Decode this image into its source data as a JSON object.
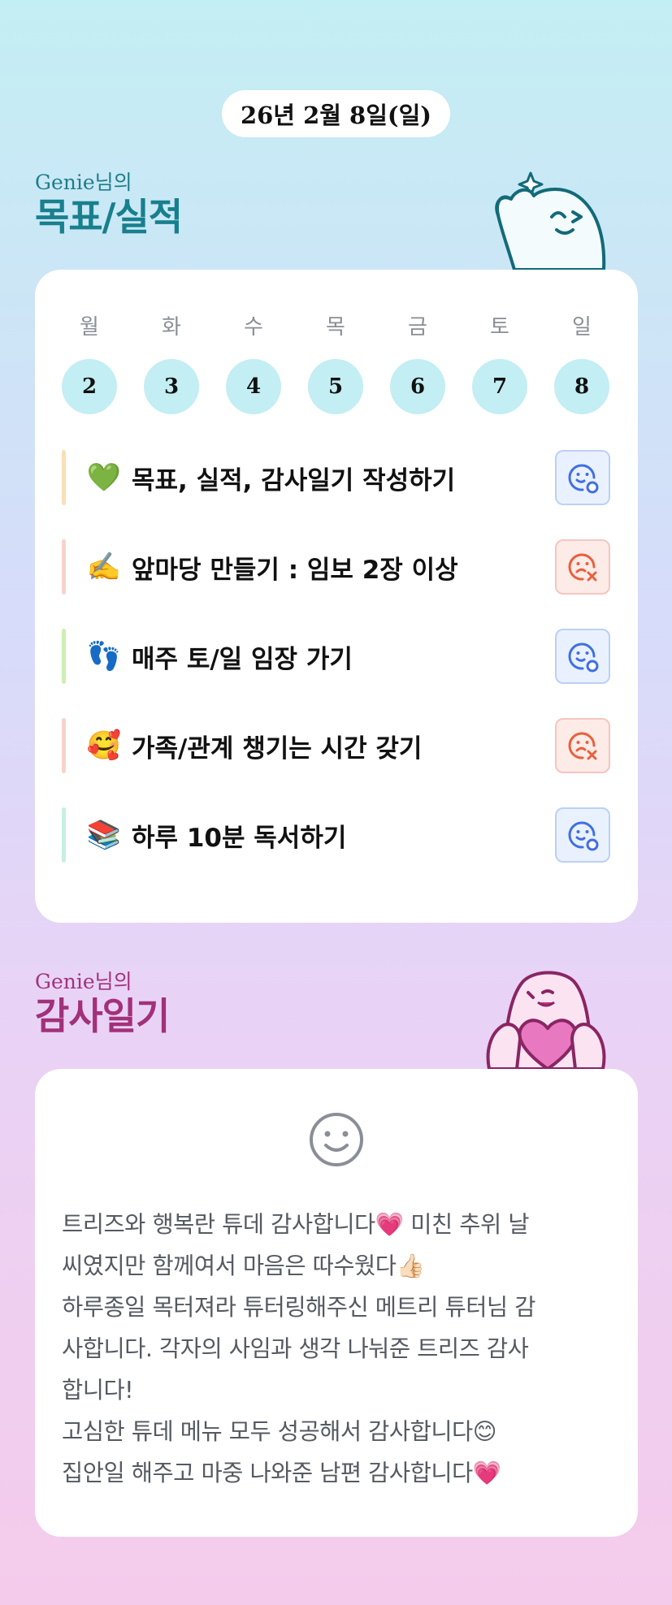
{
  "header": {
    "date": "26년 2월 8일(일)"
  },
  "goals_section": {
    "owner": "Genie님의",
    "title": "목표/실적",
    "weekdays": [
      "월",
      "화",
      "수",
      "목",
      "금",
      "토",
      "일"
    ],
    "dates": [
      "2",
      "3",
      "4",
      "5",
      "6",
      "7",
      "8"
    ],
    "items": [
      {
        "emoji": "💚",
        "label": "목표, 실적, 감사일기 작성하기",
        "status": "done",
        "status_icon": "smile-check-icon",
        "bar_color": "#f9dfb8"
      },
      {
        "emoji": "✍️",
        "label": "앞마당 만들기 : 임보 2장 이상",
        "status": "fail",
        "status_icon": "frown-x-icon",
        "bar_color": "#f8d3cc"
      },
      {
        "emoji": "👣",
        "label": "매주 토/일 임장 가기",
        "status": "done",
        "status_icon": "smile-check-icon",
        "bar_color": "#cfeeb4"
      },
      {
        "emoji": "🥰",
        "label": "가족/관계 챙기는 시간 갖기",
        "status": "fail",
        "status_icon": "frown-x-icon",
        "bar_color": "#f8d3cc"
      },
      {
        "emoji": "📚",
        "label": "하루 10분 독서하기",
        "status": "done",
        "status_icon": "smile-check-icon",
        "bar_color": "#c6f0df"
      }
    ],
    "colors": {
      "day_circle": "#c3eef3",
      "done": "#3f6fe3",
      "fail": "#e8603c"
    }
  },
  "diary_section": {
    "owner": "Genie님의",
    "title": "감사일기",
    "mood_icon": "smile-face-icon",
    "lines": [
      "트리즈와 행복란 튜데 감사합니다💗 미친 추위 날",
      "씨였지만 함께여서 마음은 따수웠다👍🏻",
      "하루종일 목터져라 튜터링해주신 메트리 튜터님 감",
      "사합니다. 각자의 사임과 생각 나눠준 트리즈 감사",
      "합니다!",
      "고심한 튜데 메뉴 모두 성공해서 감사합니다😊",
      "집안일 해주고 마중 나와준 남편 감사합니다💗"
    ]
  }
}
